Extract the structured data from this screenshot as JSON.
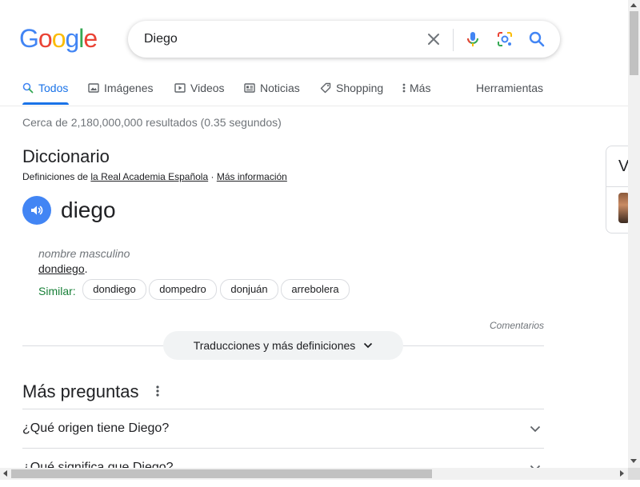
{
  "logo": {
    "letters": [
      "G",
      "o",
      "o",
      "g",
      "l",
      "e"
    ],
    "colors": [
      "#4285f4",
      "#ea4335",
      "#fbbc05",
      "#4285f4",
      "#34a853",
      "#ea4335"
    ]
  },
  "search": {
    "query": "Diego",
    "icons": [
      "clear-icon",
      "mic-icon",
      "lens-icon",
      "search-icon"
    ]
  },
  "tabs": [
    {
      "label": "Todos",
      "icon": "search-icon",
      "active": true
    },
    {
      "label": "Imágenes",
      "icon": "image-icon"
    },
    {
      "label": "Videos",
      "icon": "play-icon"
    },
    {
      "label": "Noticias",
      "icon": "news-icon"
    },
    {
      "label": "Shopping",
      "icon": "tag-icon"
    },
    {
      "label": "Más",
      "icon": "more-vert-icon"
    }
  ],
  "tools_label": "Herramientas",
  "stats": "Cerca de 2,180,000,000 resultados (0.35 segundos)",
  "dictionary": {
    "title": "Diccionario",
    "source_prefix": "Definiciones de ",
    "source_link": "la Real Academia Española",
    "source_sep": " · ",
    "more_info": "Más información",
    "word": "diego",
    "part_of_speech": "nombre masculino",
    "definition_link": "dondiego",
    "definition_end": ".",
    "similar_label": "Similar:",
    "similar": [
      "dondiego",
      "dompedro",
      "donjuán",
      "arrebolera"
    ],
    "feedback": "Comentarios",
    "translations_button": "Traducciones y más definiciones"
  },
  "more_questions": {
    "title": "Más preguntas",
    "questions": [
      "¿Qué origen tiene Diego?",
      "¿Qué significa que Diego?"
    ]
  },
  "knowledge_panel": {
    "letter": "V"
  },
  "colors": {
    "accent": "#1a73e8",
    "green": "#188038"
  }
}
